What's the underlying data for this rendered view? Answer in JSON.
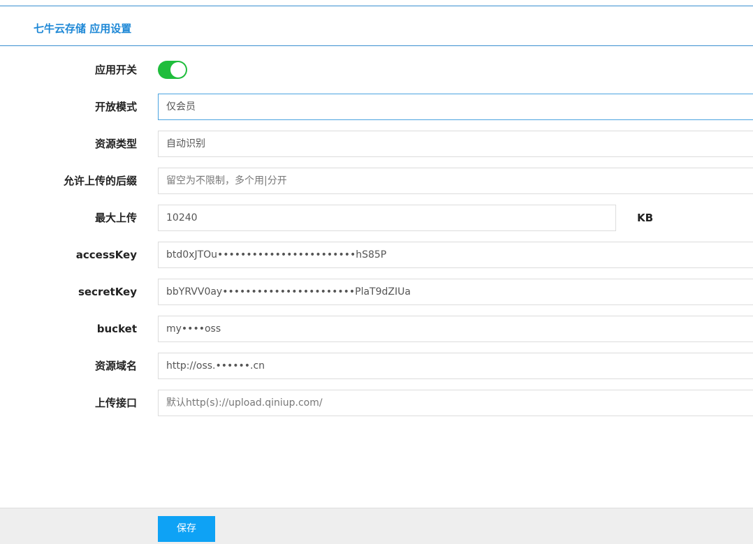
{
  "header": {
    "title": "七牛云存储 应用设置"
  },
  "form": {
    "app_switch": {
      "label": "应用开关",
      "enabled": true
    },
    "open_mode": {
      "label": "开放模式",
      "value": "仅会员"
    },
    "resource_type": {
      "label": "资源类型",
      "value": "自动识别"
    },
    "allowed_suffix": {
      "label": "允许上传的后缀",
      "placeholder": "留空为不限制，多个用|分开"
    },
    "max_upload": {
      "label": "最大上传",
      "value": "10240",
      "unit": "KB"
    },
    "access_key": {
      "label": "accessKey",
      "value": "btd0xJTOu••••••••••••••••••••••••hS85P"
    },
    "secret_key": {
      "label": "secretKey",
      "value": "bbYRVV0ay•••••••••••••••••••••••PlaT9dZIUa"
    },
    "bucket": {
      "label": "bucket",
      "value": "my••••oss"
    },
    "resource_domain": {
      "label": "资源域名",
      "value": "http://oss.••••••.cn"
    },
    "upload_endpoint": {
      "label": "上传接口",
      "placeholder": "默认http(s)://upload.qiniup.com/"
    }
  },
  "footer": {
    "save_label": "保存"
  },
  "colors": {
    "accent": "#1e88d6",
    "toggle_on": "#1fbd3c",
    "button": "#0ea2f5"
  }
}
